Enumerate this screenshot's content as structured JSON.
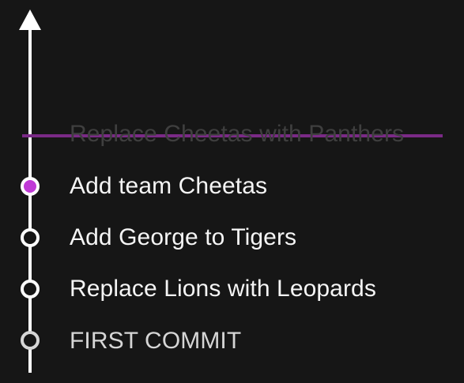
{
  "timeline": {
    "removed_commit": {
      "label": "Replace Cheetas with Panthers",
      "text_color": "#3f3f3f",
      "strike_color": "#7a2a86"
    },
    "commits": [
      {
        "label": "Add team Cheetas",
        "state": "current",
        "text_color": "#f5f5f5",
        "node_fill": "#c03ad6",
        "node_stroke": "#ffffff"
      },
      {
        "label": "Add George to Tigers",
        "state": "normal",
        "text_color": "#f5f5f5",
        "node_fill": "#161616",
        "node_stroke": "#ffffff"
      },
      {
        "label": "Replace Lions with Leopards",
        "state": "normal",
        "text_color": "#f5f5f5",
        "node_fill": "#161616",
        "node_stroke": "#ffffff"
      },
      {
        "label": "FIRST COMMIT",
        "state": "initial",
        "text_color": "#d6d6d6",
        "node_fill": "#161616",
        "node_stroke": "#d6d6d6"
      }
    ],
    "axis_color": "#ffffff",
    "background": "#161616"
  }
}
